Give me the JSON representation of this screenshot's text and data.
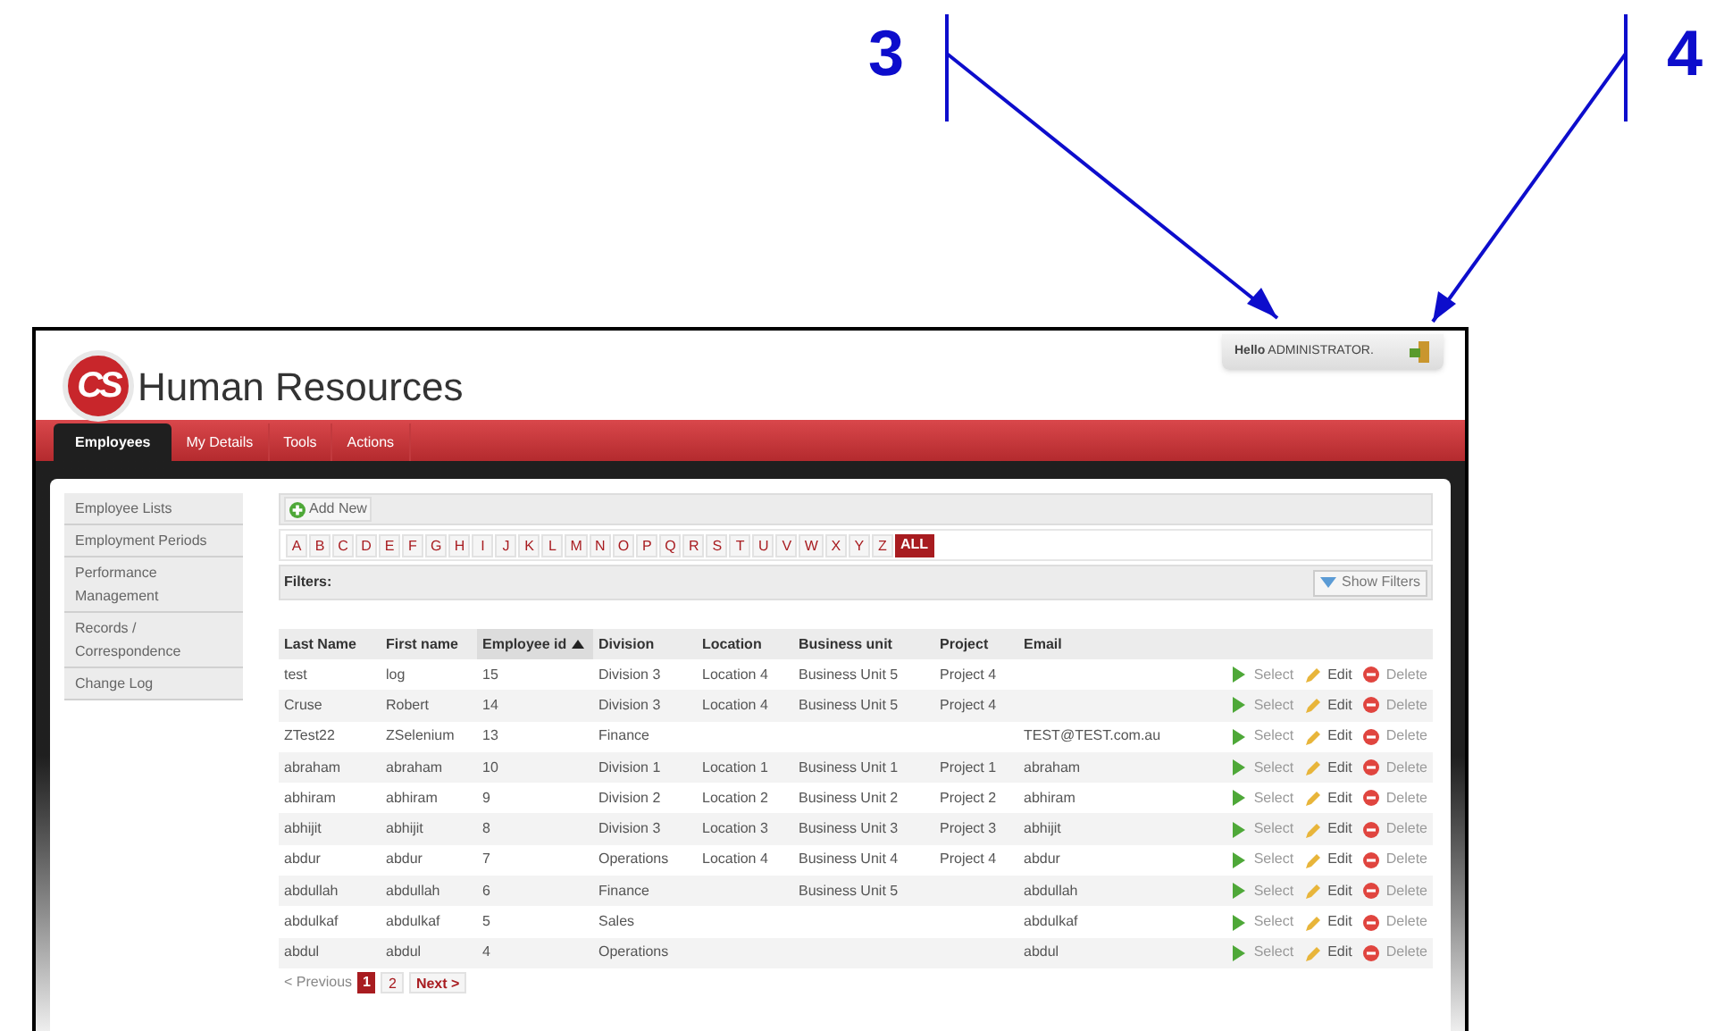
{
  "annotations": [
    {
      "label": "3"
    },
    {
      "label": "4"
    }
  ],
  "header": {
    "logo": "CS",
    "title": "Human Resources",
    "greeting": "**Hello** ADMINISTRATOR."
  },
  "nav": [
    {
      "label": "Employees",
      "selected": true
    },
    {
      "label": "My Details",
      "selected": false
    },
    {
      "label": "Tools",
      "selected": false
    },
    {
      "label": "Actions",
      "selected": false
    }
  ],
  "sidebar": {
    "items": [
      {
        "label": "Employee Lists"
      },
      {
        "label": "Employment Periods"
      },
      {
        "label": "Performance Management"
      },
      {
        "label": "Records / Correspondence"
      },
      {
        "label": "Change Log"
      }
    ]
  },
  "toolbar": {
    "add_new": "Add New"
  },
  "letters": [
    {
      "label": "A",
      "selected": false
    },
    {
      "label": "B",
      "selected": false
    },
    {
      "label": "C",
      "selected": false
    },
    {
      "label": "D",
      "selected": false
    },
    {
      "label": "E",
      "selected": false
    },
    {
      "label": "F",
      "selected": false
    },
    {
      "label": "G",
      "selected": false
    },
    {
      "label": "H",
      "selected": false
    },
    {
      "label": "I",
      "selected": false
    },
    {
      "label": "J",
      "selected": false
    },
    {
      "label": "K",
      "selected": false
    },
    {
      "label": "L",
      "selected": false
    },
    {
      "label": "M",
      "selected": false
    },
    {
      "label": "N",
      "selected": false
    },
    {
      "label": "O",
      "selected": false
    },
    {
      "label": "P",
      "selected": false
    },
    {
      "label": "Q",
      "selected": false
    },
    {
      "label": "R",
      "selected": false
    },
    {
      "label": "S",
      "selected": false
    },
    {
      "label": "T",
      "selected": false
    },
    {
      "label": "U",
      "selected": false
    },
    {
      "label": "V",
      "selected": false
    },
    {
      "label": "W",
      "selected": false
    },
    {
      "label": "X",
      "selected": false
    },
    {
      "label": "Y",
      "selected": false
    },
    {
      "label": "Z",
      "selected": false
    },
    {
      "label": "ALL",
      "selected": true
    }
  ],
  "filters": {
    "label": "Filters:",
    "show_filters": "Show Filters"
  },
  "table": {
    "columns": [
      {
        "label": "Last Name",
        "sorted": false
      },
      {
        "label": "First name",
        "sorted": false
      },
      {
        "label": "Employee id",
        "sorted": true
      },
      {
        "label": "Division",
        "sorted": false
      },
      {
        "label": "Location",
        "sorted": false
      },
      {
        "label": "Business unit",
        "sorted": false
      },
      {
        "label": "Project",
        "sorted": false
      },
      {
        "label": "Email",
        "sorted": false
      }
    ],
    "rows": [
      {
        "cells": [
          "test",
          "log",
          "15",
          "Division 3",
          "Location 4",
          "Business Unit 5",
          "Project 4",
          ""
        ],
        "actions": [
          "Select",
          "Edit",
          "Delete"
        ]
      },
      {
        "cells": [
          "Cruse",
          "Robert",
          "14",
          "Division 3",
          "Location 4",
          "Business Unit 5",
          "Project 4",
          ""
        ],
        "actions": [
          "Select",
          "Edit",
          "Delete"
        ]
      },
      {
        "cells": [
          "ZTest22",
          "ZSelenium",
          "13",
          "Finance",
          "",
          "",
          "",
          "TEST@TEST.com.au"
        ],
        "actions": [
          "Select",
          "Edit",
          "Delete"
        ]
      },
      {
        "cells": [
          "abraham",
          "abraham",
          "10",
          "Division 1",
          "Location 1",
          "Business Unit 1",
          "Project 1",
          "abraham"
        ],
        "actions": [
          "Select",
          "Edit",
          "Delete"
        ]
      },
      {
        "cells": [
          "abhiram",
          "abhiram",
          "9",
          "Division 2",
          "Location 2",
          "Business Unit 2",
          "Project 2",
          "abhiram"
        ],
        "actions": [
          "Select",
          "Edit",
          "Delete"
        ]
      },
      {
        "cells": [
          "abhijit",
          "abhijit",
          "8",
          "Division 3",
          "Location 3",
          "Business Unit 3",
          "Project 3",
          "abhijit"
        ],
        "actions": [
          "Select",
          "Edit",
          "Delete"
        ]
      },
      {
        "cells": [
          "abdur",
          "abdur",
          "7",
          "Operations",
          "Location 4",
          "Business Unit 4",
          "Project 4",
          "abdur"
        ],
        "actions": [
          "Select",
          "Edit",
          "Delete"
        ]
      },
      {
        "cells": [
          "abdullah",
          "abdullah",
          "6",
          "Finance",
          "",
          "Business Unit 5",
          "",
          "abdullah"
        ],
        "actions": [
          "Select",
          "Edit",
          "Delete"
        ]
      },
      {
        "cells": [
          "abdulkaf",
          "abdulkaf",
          "5",
          "Sales",
          "",
          "",
          "",
          "abdulkaf"
        ],
        "actions": [
          "Select",
          "Edit",
          "Delete"
        ]
      },
      {
        "cells": [
          "abdul",
          "abdul",
          "4",
          "Operations",
          "",
          "",
          "",
          "abdul"
        ],
        "actions": [
          "Select",
          "Edit",
          "Delete"
        ]
      }
    ]
  },
  "pagination": {
    "previous": "< Previous",
    "pages": [
      {
        "label": "1",
        "selected": true
      },
      {
        "label": "2",
        "selected": false
      }
    ],
    "next": "Next >"
  }
}
